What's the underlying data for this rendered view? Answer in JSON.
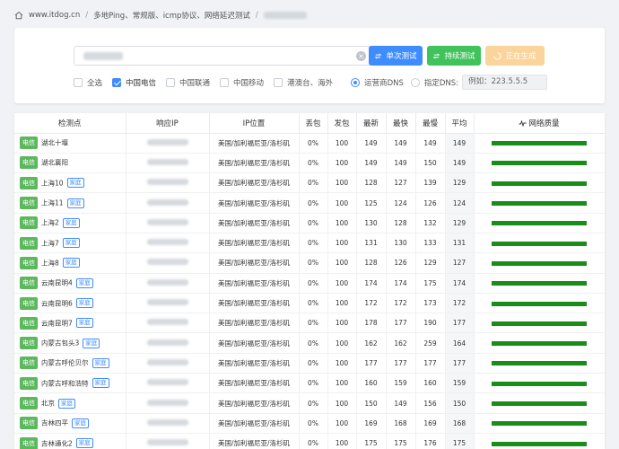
{
  "breadcrumb": {
    "site": "www.itdog.cn",
    "section": "多地Ping、常规版、icmp协议、网络延迟测试"
  },
  "form": {
    "clear_icon": "close-icon",
    "single_test_label": "单次测试",
    "continuous_test_label": "持续测试",
    "generating_label": "正在生成"
  },
  "isp_filters": [
    {
      "label": "全选",
      "checked": false
    },
    {
      "label": "中国电信",
      "checked": true
    },
    {
      "label": "中国联通",
      "checked": false
    },
    {
      "label": "中国移动",
      "checked": false
    },
    {
      "label": "港澳台、海外",
      "checked": false
    }
  ],
  "dns": {
    "isp_dns_label": "运营商DNS",
    "custom_dns_label": "指定DNS:",
    "custom_dns_placeholder": "例如：223.5.5.5",
    "selected": "isp"
  },
  "table": {
    "headers": [
      "检测点",
      "响应IP",
      "IP位置",
      "丢包",
      "发包",
      "最新",
      "最快",
      "最慢",
      "平均",
      "网络质量"
    ],
    "quality_icon": "activity-icon",
    "home_tag": "家庭",
    "rows": [
      {
        "isp": "电信",
        "node": "湖北十堰",
        "home": false,
        "loc": "美国/加利福尼亚/洛杉矶",
        "loss": "0%",
        "sent": "100",
        "latest": "149",
        "fastest": "149",
        "slowest": "149",
        "avg": "149"
      },
      {
        "isp": "电信",
        "node": "湖北襄阳",
        "home": false,
        "loc": "美国/加利福尼亚/洛杉矶",
        "loss": "0%",
        "sent": "100",
        "latest": "149",
        "fastest": "149",
        "slowest": "150",
        "avg": "149"
      },
      {
        "isp": "电信",
        "node": "上海10",
        "home": true,
        "loc": "美国/加利福尼亚/洛杉矶",
        "loss": "0%",
        "sent": "100",
        "latest": "128",
        "fastest": "127",
        "slowest": "139",
        "avg": "129"
      },
      {
        "isp": "电信",
        "node": "上海11",
        "home": true,
        "loc": "美国/加利福尼亚/洛杉矶",
        "loss": "0%",
        "sent": "100",
        "latest": "125",
        "fastest": "124",
        "slowest": "126",
        "avg": "124"
      },
      {
        "isp": "电信",
        "node": "上海2",
        "home": true,
        "loc": "美国/加利福尼亚/洛杉矶",
        "loss": "0%",
        "sent": "100",
        "latest": "130",
        "fastest": "128",
        "slowest": "132",
        "avg": "129"
      },
      {
        "isp": "电信",
        "node": "上海7",
        "home": true,
        "loc": "美国/加利福尼亚/洛杉矶",
        "loss": "0%",
        "sent": "100",
        "latest": "131",
        "fastest": "130",
        "slowest": "133",
        "avg": "131"
      },
      {
        "isp": "电信",
        "node": "上海8",
        "home": true,
        "loc": "美国/加利福尼亚/洛杉矶",
        "loss": "0%",
        "sent": "100",
        "latest": "128",
        "fastest": "126",
        "slowest": "129",
        "avg": "127"
      },
      {
        "isp": "电信",
        "node": "云南昆明4",
        "home": true,
        "loc": "美国/加利福尼亚/洛杉矶",
        "loss": "0%",
        "sent": "100",
        "latest": "174",
        "fastest": "174",
        "slowest": "175",
        "avg": "174"
      },
      {
        "isp": "电信",
        "node": "云南昆明6",
        "home": true,
        "loc": "美国/加利福尼亚/洛杉矶",
        "loss": "0%",
        "sent": "100",
        "latest": "172",
        "fastest": "172",
        "slowest": "173",
        "avg": "172"
      },
      {
        "isp": "电信",
        "node": "云南昆明7",
        "home": true,
        "loc": "美国/加利福尼亚/洛杉矶",
        "loss": "0%",
        "sent": "100",
        "latest": "178",
        "fastest": "177",
        "slowest": "190",
        "avg": "177"
      },
      {
        "isp": "电信",
        "node": "内蒙古包头3",
        "home": true,
        "loc": "美国/加利福尼亚/洛杉矶",
        "loss": "0%",
        "sent": "100",
        "latest": "162",
        "fastest": "162",
        "slowest": "259",
        "avg": "164"
      },
      {
        "isp": "电信",
        "node": "内蒙古呼伦贝尔",
        "home": true,
        "loc": "美国/加利福尼亚/洛杉矶",
        "loss": "0%",
        "sent": "100",
        "latest": "177",
        "fastest": "177",
        "slowest": "177",
        "avg": "177"
      },
      {
        "isp": "电信",
        "node": "内蒙古呼和浩特",
        "home": true,
        "loc": "美国/加利福尼亚/洛杉矶",
        "loss": "0%",
        "sent": "100",
        "latest": "160",
        "fastest": "159",
        "slowest": "160",
        "avg": "159"
      },
      {
        "isp": "电信",
        "node": "北京",
        "home": true,
        "loc": "美国/加利福尼亚/洛杉矶",
        "loss": "0%",
        "sent": "100",
        "latest": "150",
        "fastest": "149",
        "slowest": "156",
        "avg": "150"
      },
      {
        "isp": "电信",
        "node": "吉林四平",
        "home": true,
        "loc": "美国/加利福尼亚/洛杉矶",
        "loss": "0%",
        "sent": "100",
        "latest": "169",
        "fastest": "168",
        "slowest": "169",
        "avg": "168"
      },
      {
        "isp": "电信",
        "node": "吉林通化2",
        "home": true,
        "loc": "美国/加利福尼亚/洛杉矶",
        "loss": "0%",
        "sent": "100",
        "latest": "175",
        "fastest": "175",
        "slowest": "176",
        "avg": "175"
      }
    ]
  },
  "colors": {
    "primary": "#3f8cff",
    "success": "#3fc35a",
    "warning_light": "#fbd49b",
    "isp_badge": "#5bb85d",
    "quality_bar": "#1a8c1a"
  }
}
